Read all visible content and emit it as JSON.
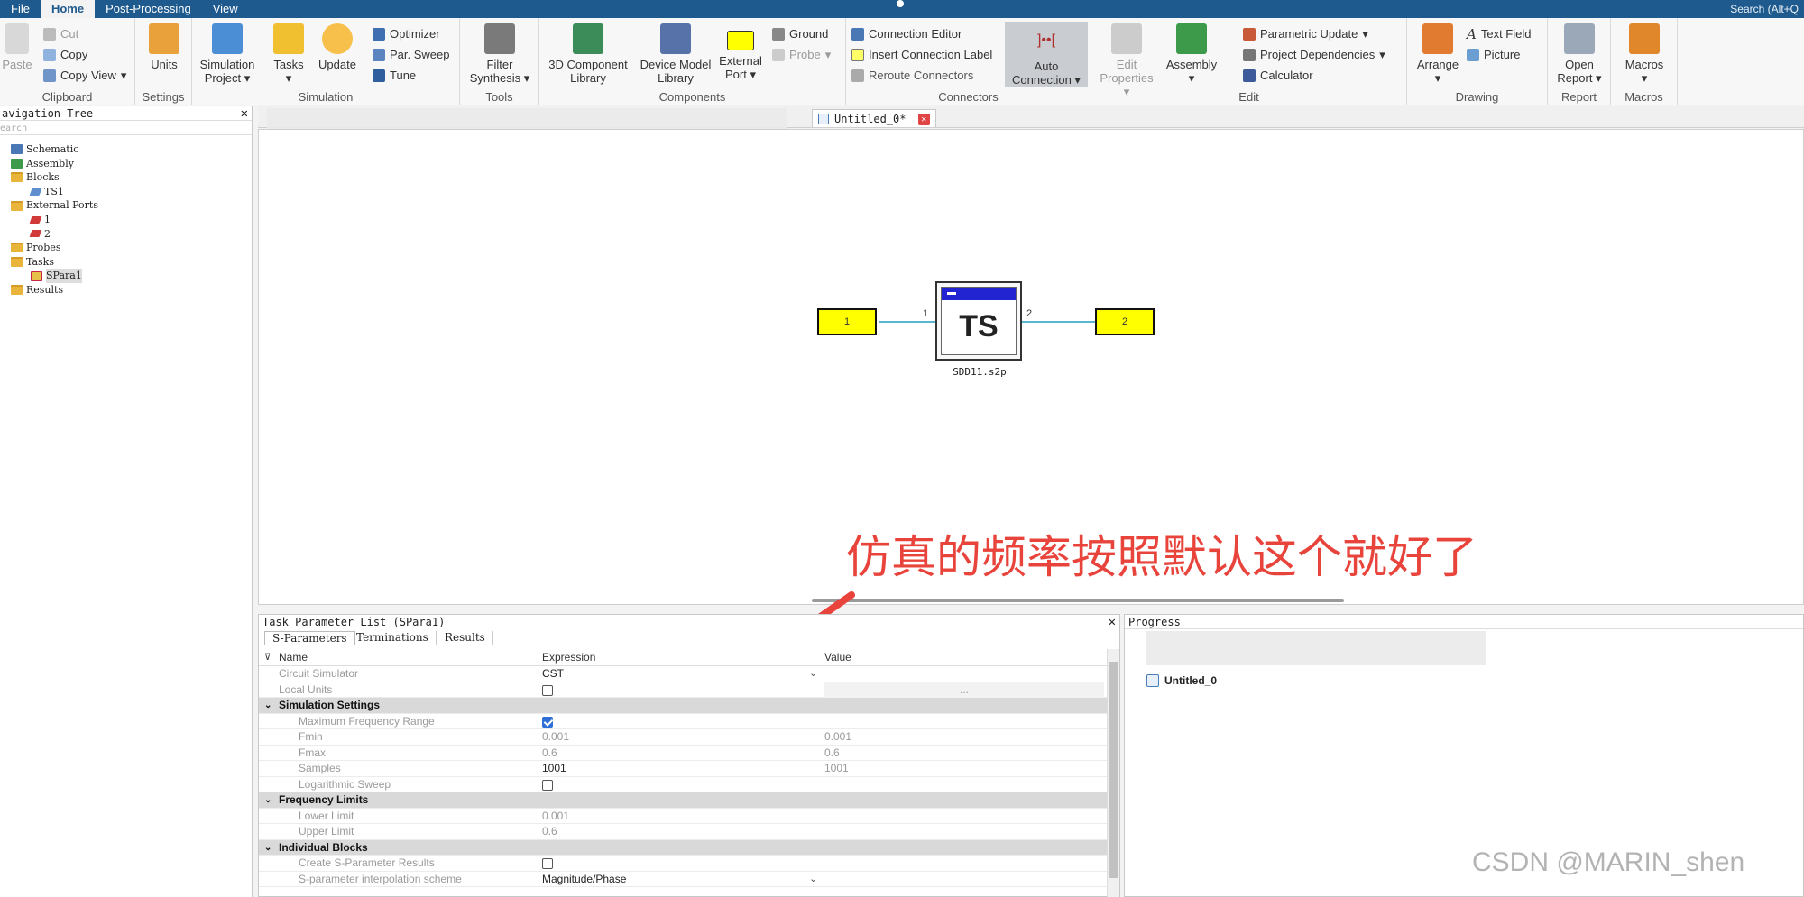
{
  "menubar": {
    "items": [
      "File",
      "Home",
      "Post-Processing",
      "View"
    ],
    "active": "Home",
    "search": "Search (Alt+Q"
  },
  "ribbon": {
    "clipboard": {
      "label": "Clipboard",
      "paste": "Paste",
      "cut": "Cut",
      "copy": "Copy",
      "copy_view": "Copy View"
    },
    "settings": {
      "label": "Settings",
      "units": "Units"
    },
    "simulation": {
      "label": "Simulation",
      "simulation_project": "Simulation Project",
      "tasks": "Tasks",
      "update": "Update",
      "optimizer": "Optimizer",
      "par_sweep": "Par. Sweep",
      "tune": "Tune"
    },
    "tools": {
      "label": "Tools",
      "filter_synthesis": "Filter Synthesis"
    },
    "components": {
      "label": "Components",
      "component_library": "3D Component Library",
      "device_model_library": "Device Model Library",
      "external_port": "External Port",
      "ground": "Ground",
      "probe": "Probe"
    },
    "connectors": {
      "label": "Connectors",
      "connection_editor": "Connection Editor",
      "insert_connection_label": "Insert Connection Label",
      "reroute_connectors": "Reroute Connectors",
      "auto_connection": "Auto Connection"
    },
    "edit": {
      "label": "Edit",
      "edit_properties": "Edit Properties",
      "assembly": "Assembly",
      "parametric_update": "Parametric Update",
      "project_dependencies": "Project Dependencies",
      "calculator": "Calculator"
    },
    "drawing": {
      "label": "Drawing",
      "arrange": "Arrange",
      "text_field": "Text Field",
      "picture": "Picture"
    },
    "report": {
      "label": "Report",
      "open_report": "Open Report"
    },
    "macros": {
      "label": "Macros",
      "macros": "Macros"
    }
  },
  "navigation": {
    "title": "avigation Tree",
    "search_placeholder": "earch",
    "tree": [
      {
        "label": "Schematic",
        "level": 0
      },
      {
        "label": "Assembly",
        "level": 0
      },
      {
        "label": "Blocks",
        "level": 0
      },
      {
        "label": "TS1",
        "level": 1
      },
      {
        "label": "External Ports",
        "level": 0
      },
      {
        "label": "1",
        "level": 1
      },
      {
        "label": "2",
        "level": 1
      },
      {
        "label": "Probes",
        "level": 0
      },
      {
        "label": "Tasks",
        "level": 0
      },
      {
        "label": "SPara1",
        "level": 1
      },
      {
        "label": "Results",
        "level": 0
      }
    ]
  },
  "tabs": {
    "active_tab": "Untitled_0*"
  },
  "schematic": {
    "port1_label": "1",
    "port2_label": "2",
    "pin1": "1",
    "pin2": "2",
    "block_text": "TS",
    "block_name": "SDD11.s2p"
  },
  "annotation": "仿真的频率按照默认这个就好了",
  "task_panel": {
    "title": "Task Parameter List (SPara1)",
    "subtabs": [
      "S-Parameters",
      "Terminations",
      "Results"
    ],
    "columns": {
      "name": "Name",
      "expression": "Expression",
      "value": "Value"
    },
    "rows": {
      "circuit_simulator": {
        "name": "Circuit Simulator",
        "expr": "CST"
      },
      "local_units": {
        "name": "Local Units",
        "value": "..."
      },
      "simulation_settings": "Simulation Settings",
      "max_freq_range": {
        "name": "Maximum Frequency Range"
      },
      "fmin": {
        "name": "Fmin",
        "expr": "0.001",
        "value": "0.001"
      },
      "fmax": {
        "name": "Fmax",
        "expr": "0.6",
        "value": "0.6"
      },
      "samples": {
        "name": "Samples",
        "expr": "1001",
        "value": "1001"
      },
      "log_sweep": {
        "name": "Logarithmic Sweep"
      },
      "frequency_limits": "Frequency Limits",
      "lower_limit": {
        "name": "Lower Limit",
        "expr": "0.001"
      },
      "upper_limit": {
        "name": "Upper Limit",
        "expr": "0.6"
      },
      "individual_blocks": "Individual Blocks",
      "create_sparam": {
        "name": "Create S-Parameter Results"
      },
      "interp_scheme": {
        "name": "S-parameter interpolation scheme",
        "expr": "Magnitude/Phase"
      }
    }
  },
  "progress_panel": {
    "title": "Progress",
    "item": "Untitled_0"
  },
  "watermark": "CSDN @MARIN_shen",
  "colors": {
    "menubar": "#1e5a8e",
    "port": "#ffff00",
    "block_header": "#2124d0",
    "annotation": "#e8443c",
    "wire": "#5bb6cf"
  }
}
